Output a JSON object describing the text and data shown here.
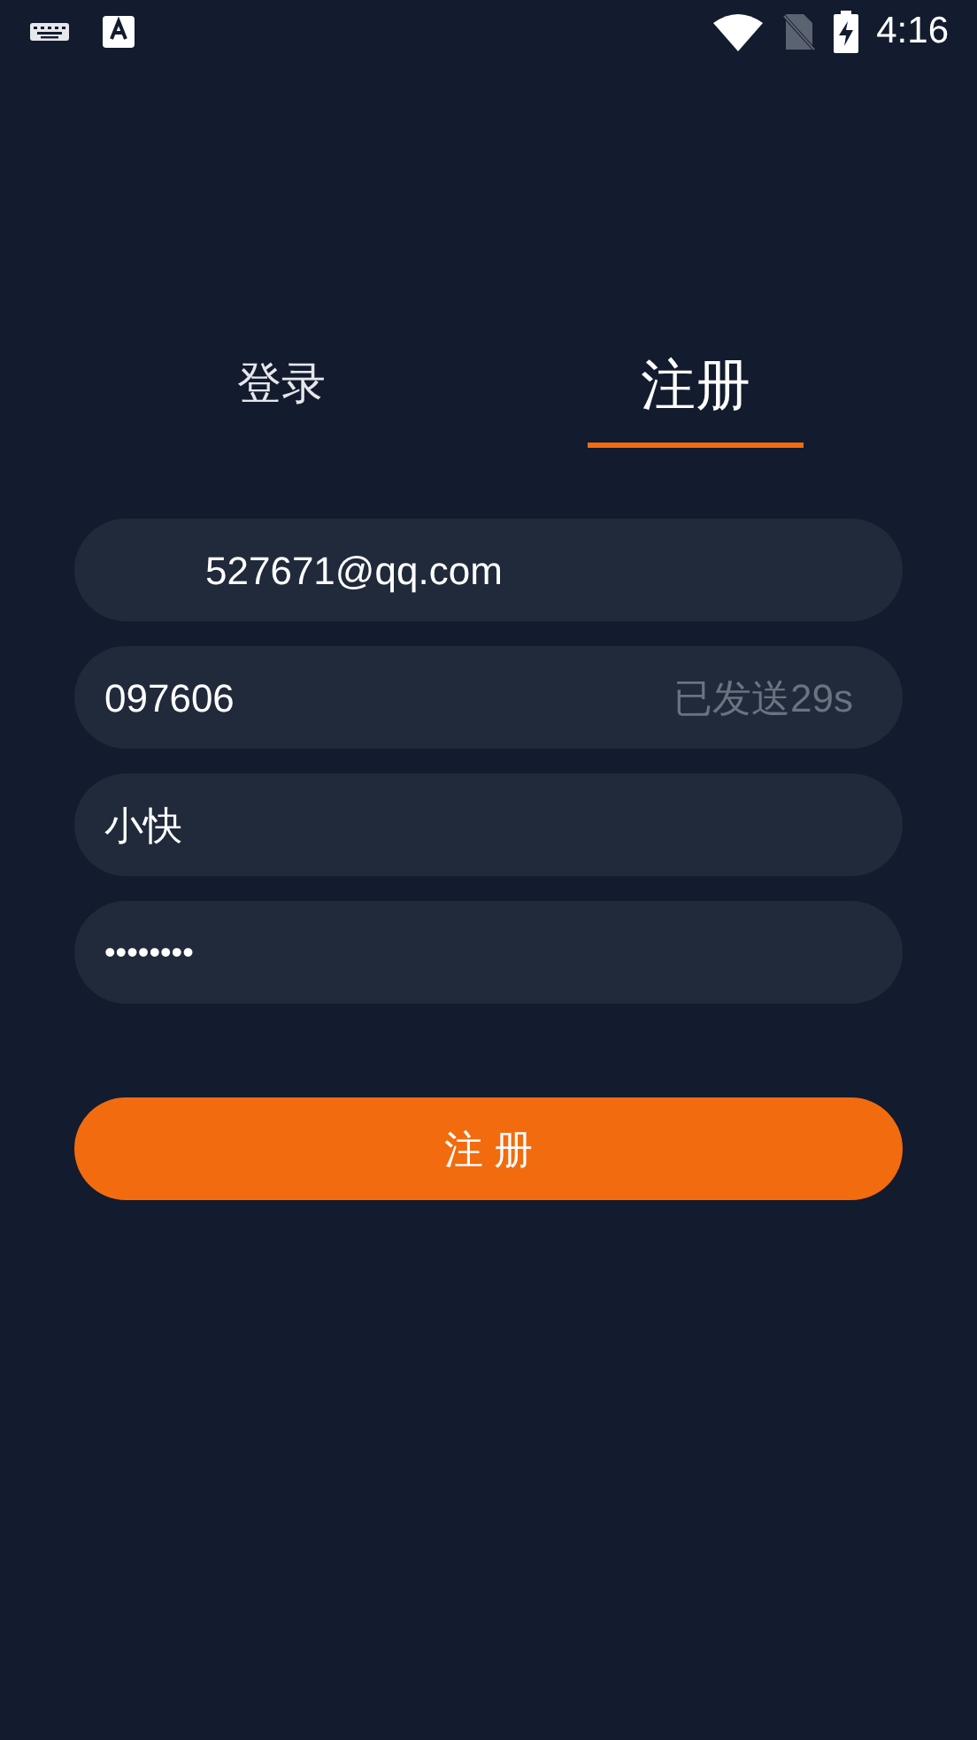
{
  "status_bar": {
    "time": "4:16"
  },
  "tabs": [
    {
      "label": "登录",
      "selected": false
    },
    {
      "label": "注册",
      "selected": true
    }
  ],
  "fields": [
    {
      "kind": "email",
      "value": "527671@qq.com"
    },
    {
      "kind": "code",
      "value": "097606",
      "suffix": "已发送29s"
    },
    {
      "kind": "nickname",
      "value": "小快"
    },
    {
      "kind": "password",
      "value": "••••••••"
    }
  ],
  "submit_button": "注 册"
}
